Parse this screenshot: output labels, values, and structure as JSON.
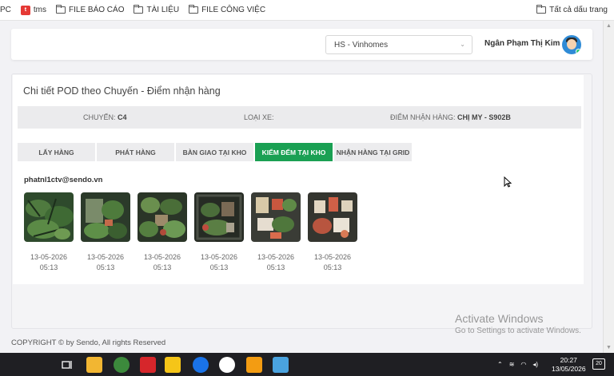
{
  "bookmarks": {
    "items": [
      {
        "label": "PC"
      },
      {
        "label": "tms"
      },
      {
        "label": "FILE BÁO CÁO"
      },
      {
        "label": "TÀI LIỆU"
      },
      {
        "label": "FILE CÔNG VIỆC"
      }
    ],
    "all_bookmarks": "Tất cả dấu trang"
  },
  "header": {
    "site_select": "HS - Vinhomes",
    "user_name": "Ngân Phạm Thị Kim"
  },
  "main": {
    "title": "Chi tiết POD theo Chuyến - Điểm nhận hàng",
    "info": {
      "trip_label": "CHUYẾN:",
      "trip_value": "C4",
      "vehicle_label": "LOẠI XE:",
      "vehicle_value": "",
      "point_label": "ĐIỂM NHẬN HÀNG:",
      "point_value": "CHỊ MY - S902B"
    },
    "tabs": [
      {
        "label": "LẤY HÀNG"
      },
      {
        "label": "PHÁT HÀNG"
      },
      {
        "label": "BÀN GIAO TẠI KHO"
      },
      {
        "label": "KIỂM ĐẾM TẠI KHO"
      },
      {
        "label": "NHẬN HÀNG TẠI GRID"
      }
    ],
    "active_tab": "KIỂM ĐẾM TẠI KHO",
    "email": "phatnl1ctv@sendo.vn",
    "photos": [
      {
        "date": "13-05-2026",
        "time": "05:13"
      },
      {
        "date": "13-05-2026",
        "time": "05:13"
      },
      {
        "date": "13-05-2026",
        "time": "05:13"
      },
      {
        "date": "13-05-2026",
        "time": "05:13"
      },
      {
        "date": "13-05-2026",
        "time": "05:13"
      },
      {
        "date": "13-05-2026",
        "time": "05:13"
      }
    ]
  },
  "footer": {
    "copyright": "COPYRIGHT © by Sendo, All rights Reserved"
  },
  "watermark": {
    "line1": "Activate Windows",
    "line2": "Go to Settings to activate Windows."
  },
  "taskbar": {
    "time": "20:27",
    "date": "13/05/2026",
    "notifications": "20"
  },
  "colors": {
    "accent": "#1aa053",
    "avatar": "#2f8bd6"
  }
}
